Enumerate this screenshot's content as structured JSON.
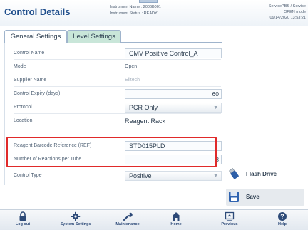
{
  "header": {
    "title": "Control Details",
    "instrument_name_label": "Instrument Name : 2006B001",
    "instrument_status_label": "Instrument Status : READY",
    "user_line": "ServicePBS / Service",
    "mode_line": "OPEN mode",
    "datetime": "09/14/2020 13:53:21"
  },
  "tabs": [
    {
      "label": "General Settings",
      "active": true
    },
    {
      "label": "Level Settings",
      "active": false
    }
  ],
  "fields": [
    {
      "label": "Control Name",
      "value": "CMV Positive Control_A",
      "kind": "input-left"
    },
    {
      "label": "Mode",
      "value": "Open",
      "kind": "text-small"
    },
    {
      "label": "Supplier Name",
      "value": "Elitech",
      "kind": "text-muted"
    },
    {
      "label": "Control Expiry (days)",
      "value": "60",
      "kind": "input-right"
    },
    {
      "label": "Protocol",
      "value": "PCR Only",
      "kind": "select"
    },
    {
      "label": "Location",
      "value": "Reagent Rack",
      "kind": "text"
    },
    {
      "label": "Reagent Barcode Reference (REF)",
      "value": "STD015PLD",
      "kind": "input-left"
    },
    {
      "label": "Number of Reactions per Tube",
      "value": "8",
      "kind": "input-right"
    },
    {
      "label": "Control Type",
      "value": "Positive",
      "kind": "select"
    }
  ],
  "side_buttons": {
    "flash_drive": "Flash Drive",
    "save": "Save"
  },
  "toolbar": {
    "logout": "Log out",
    "system_settings": "System Settings",
    "maintenance": "Maintenance",
    "home": "Home",
    "previous": "Previous",
    "help": "Help"
  },
  "colors": {
    "accent": "#1f4e8c",
    "highlight": "#e02a2a",
    "tab_inactive": "#c9e6d9"
  }
}
